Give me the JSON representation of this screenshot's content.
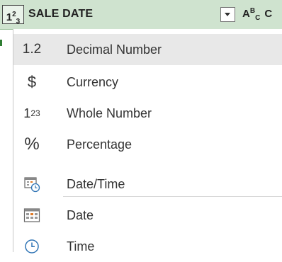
{
  "header": {
    "type_icon": "whole-number-type-icon",
    "column_name": "SALE DATE",
    "next_column_type_icon": "text-type-icon",
    "next_column_partial": "C"
  },
  "menu": {
    "items": [
      {
        "icon": "1.2",
        "icon_name": "decimal-number-icon",
        "label": "Decimal Number",
        "selected": true
      },
      {
        "icon": "$",
        "icon_name": "currency-icon",
        "label": "Currency",
        "selected": false
      },
      {
        "icon": "123",
        "icon_name": "whole-number-icon",
        "label": "Whole Number",
        "selected": false
      },
      {
        "icon": "%",
        "icon_name": "percentage-icon",
        "label": "Percentage",
        "selected": false
      },
      {
        "icon": "datetime",
        "icon_name": "date-time-icon",
        "label": "Date/Time",
        "selected": false
      },
      {
        "icon": "date",
        "icon_name": "calendar-icon",
        "label": "Date",
        "selected": false
      },
      {
        "icon": "time",
        "icon_name": "clock-icon",
        "label": "Time",
        "selected": false
      }
    ]
  },
  "colors": {
    "header_bg": "#cfe3cf",
    "selected_bg": "#e8e8e8",
    "icon_blue": "#2f74b5",
    "icon_orange": "#e07b28"
  }
}
